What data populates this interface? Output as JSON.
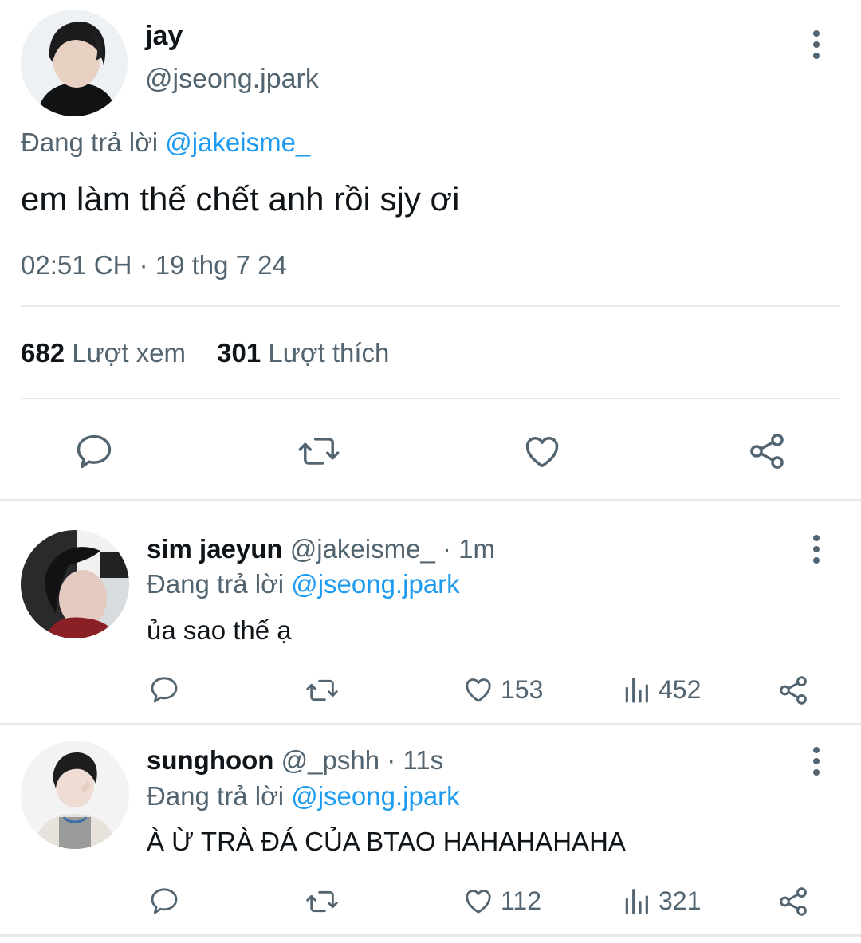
{
  "tweet": {
    "author_name": "jay",
    "author_handle": "@jseong.jpark",
    "reply_prefix": "Đang trả lời",
    "reply_to": "@jakeisme_",
    "text": "em làm thế chết anh rồi sjy ơi",
    "timestamp": "02:51 CH · 19 thg 7 24",
    "views_count": "682",
    "views_label": "Lượt xem",
    "likes_count": "301",
    "likes_label": "Lượt thích"
  },
  "replies": [
    {
      "name": "sim jaeyun",
      "handle": "@jakeisme_",
      "time": "· 1m",
      "reply_prefix": "Đang trả lời",
      "reply_to": "@jseong.jpark",
      "text": "ủa sao thế ạ",
      "likes": "153",
      "views": "452"
    },
    {
      "name": "sunghoon",
      "handle": "@_pshh",
      "time": "· 11s",
      "reply_prefix": "Đang trả lời",
      "reply_to": "@jseong.jpark",
      "text": "À Ừ TRÀ ĐÁ CỦA BTAO HAHAHAHAHA",
      "likes": "112",
      "views": "321"
    }
  ],
  "colors": {
    "accent": "#1d9bf0",
    "muted": "#536471",
    "text": "#0f1419",
    "divider": "#e6e9ec"
  },
  "icons": [
    "reply-icon",
    "retweet-icon",
    "like-icon",
    "share-icon",
    "views-icon",
    "more-icon"
  ]
}
